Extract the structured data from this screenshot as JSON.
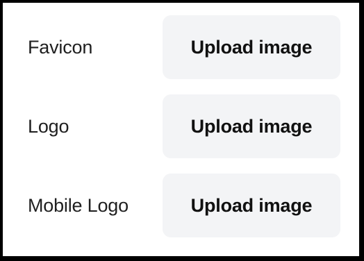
{
  "settings": {
    "rows": [
      {
        "label": "Favicon",
        "button_label": "Upload image"
      },
      {
        "label": "Logo",
        "button_label": "Upload image"
      },
      {
        "label": "Mobile Logo",
        "button_label": "Upload image"
      }
    ]
  },
  "colors": {
    "frame": "#000000",
    "panel_background": "#ffffff",
    "button_background": "#f3f4f6",
    "label_text": "#1f1f1f",
    "button_text": "#111111"
  }
}
